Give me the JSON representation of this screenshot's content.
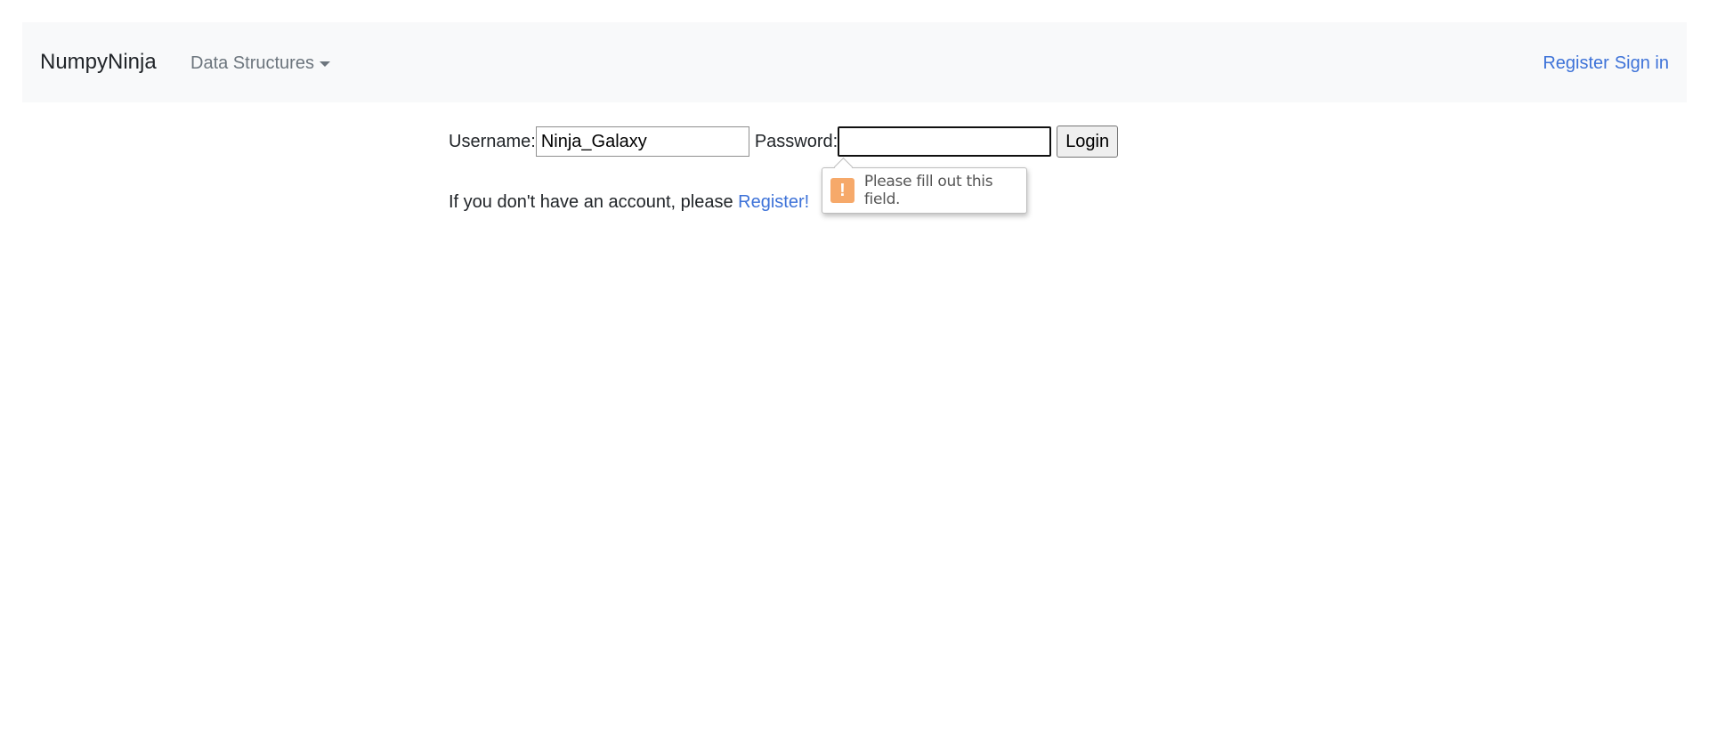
{
  "navbar": {
    "brand": "NumpyNinja",
    "dropdown_label": "Data Structures",
    "register_label": "Register",
    "signin_label": "Sign in"
  },
  "login_form": {
    "username_label": "Username:",
    "username_value": "Ninja_Galaxy",
    "password_label": "Password:",
    "password_value": "",
    "login_button": "Login"
  },
  "register_prompt": {
    "text": "If you don't have an account, please ",
    "link": "Register!"
  },
  "validation_tooltip": {
    "icon": "warning-icon",
    "icon_glyph": "!",
    "message": "Please fill out this field."
  },
  "colors": {
    "link": "#3d72d8",
    "navbar_bg": "#f8f9fa",
    "warning": "#f6a96a"
  }
}
